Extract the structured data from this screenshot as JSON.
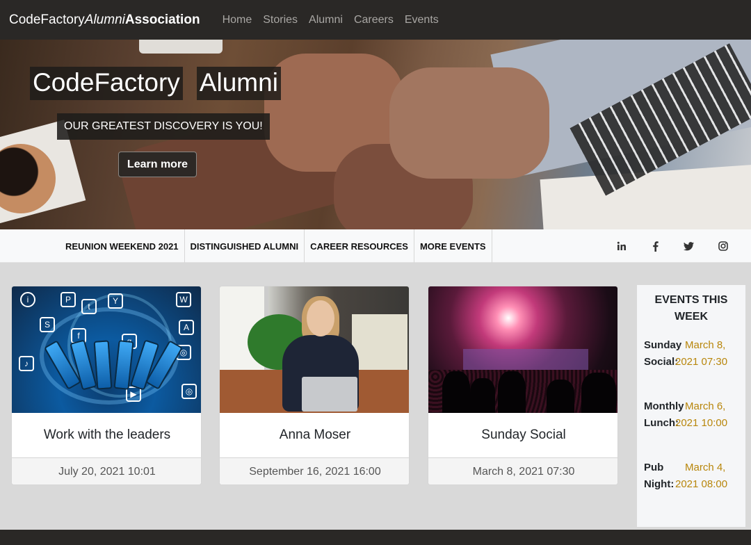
{
  "navbar": {
    "brand_part1": "CodeFactory",
    "brand_part2": "Alumni",
    "brand_part3": "Association",
    "links": [
      "Home",
      "Stories",
      "Alumni",
      "Careers",
      "Events"
    ]
  },
  "hero": {
    "title_word1": "CodeFactory",
    "title_word2": "Alumni",
    "subtitle": "OUR GREATEST DISCOVERY IS YOU!",
    "button_label": "Learn more"
  },
  "subnav": {
    "items": [
      "REUNION WEEKEND 2021",
      "DISTINGUISHED ALUMNI",
      "CAREER RESOURCES",
      "MORE EVENTS"
    ],
    "social_icons": [
      "linkedin-icon",
      "facebook-icon",
      "twitter-icon",
      "instagram-icon"
    ]
  },
  "cards": [
    {
      "title": "Work with the leaders",
      "date": "July 20, 2021 10:01",
      "image": "social-media-phones"
    },
    {
      "title": "Anna Moser",
      "date": "September 16, 2021 16:00",
      "image": "woman-on-sofa-with-laptop"
    },
    {
      "title": "Sunday Social",
      "date": "March 8, 2021 07:30",
      "image": "concert-crowd"
    }
  ],
  "events_panel": {
    "title_line1": "EVENTS THIS",
    "title_line2": "WEEK",
    "events": [
      {
        "name_line1": "Sunday",
        "name_line2": "Social:",
        "date_line1": "March 8,",
        "date_line2": "2021 07:30"
      },
      {
        "name_line1": "Monthly",
        "name_line2": "Lunch:",
        "date_line1": "March 6,",
        "date_line2": "2021 10:00"
      },
      {
        "name_line1": "Pub",
        "name_line2": "Night:",
        "date_line1": "March 4,",
        "date_line2": "2021 08:00"
      }
    ]
  },
  "colors": {
    "navbar_bg": "#2a2826",
    "event_date": "#b8860b",
    "page_bg": "#d9d9d9"
  }
}
